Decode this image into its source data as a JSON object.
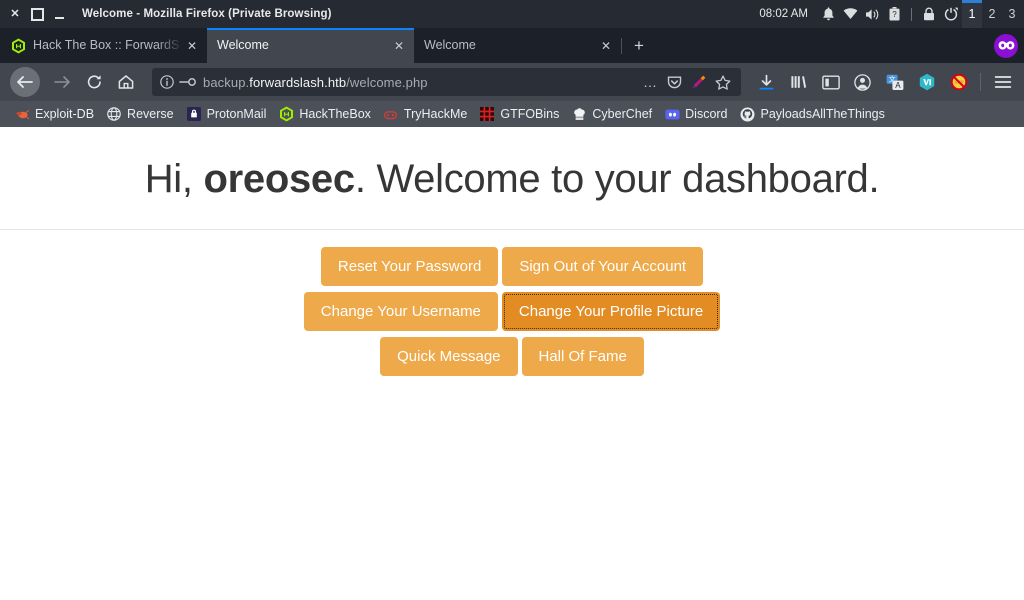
{
  "window": {
    "title": "Welcome - Mozilla Firefox (Private Browsing)",
    "controls": {
      "close": "close-window",
      "maximize": "maximize-window",
      "minimize": "minimize-window"
    }
  },
  "tray": {
    "clock": "08:02 AM",
    "icons": [
      "bell-icon",
      "wifi-icon",
      "volume-icon",
      "battery-unknown-icon"
    ],
    "session_icons": [
      "lock-screen-icon",
      "logout-icon"
    ],
    "workspaces": [
      "1",
      "2",
      "3"
    ],
    "active_workspace": "1"
  },
  "tabs": [
    {
      "title": "Hack The Box :: ForwardS",
      "favicon": "hackthebox-icon",
      "active": false,
      "close_label": "✕"
    },
    {
      "title": "Welcome",
      "favicon": "none",
      "active": true,
      "close_label": "✕"
    },
    {
      "title": "Welcome",
      "favicon": "none",
      "active": false,
      "close_label": "✕"
    }
  ],
  "tabstrip": {
    "new_tab_label": "+",
    "private_mode_icon": "private-browsing-mask-icon",
    "accent": "#0a84ff"
  },
  "navigation": {
    "back": "back-icon",
    "forward": "forward-icon",
    "reload": "reload-icon",
    "home": "home-icon"
  },
  "urlbar": {
    "identity_icon": "page-info-icon",
    "login_icon": "saved-login-key-icon",
    "url_prefix": "backup.",
    "url_host": "forwardslash.htb",
    "url_path": "/welcome.php",
    "full_url": "backup.forwardslash.htb/welcome.php",
    "page_actions_label": "…",
    "right_icons": [
      "page-actions-icon",
      "save-to-pocket-icon",
      "highlighter-icon",
      "bookmark-star-icon"
    ]
  },
  "toolbar": {
    "icons": [
      "downloads-icon",
      "library-icon",
      "sidebar-icon",
      "account-icon",
      "translate-extension-icon",
      "wappalyzer-extension-icon",
      "noscript-extension-icon"
    ],
    "menu_icon": "hamburger-menu-icon"
  },
  "bookmarks": [
    {
      "label": "Exploit-DB",
      "icon": "exploitdb-icon"
    },
    {
      "label": "Reverse",
      "icon": "globe-icon"
    },
    {
      "label": "ProtonMail",
      "icon": "protonmail-icon"
    },
    {
      "label": "HackTheBox",
      "icon": "hackthebox-icon"
    },
    {
      "label": "TryHackMe",
      "icon": "tryhackme-icon"
    },
    {
      "label": "GTFOBins",
      "icon": "gtfobins-icon"
    },
    {
      "label": "CyberChef",
      "icon": "cyberchef-icon"
    },
    {
      "label": "Discord",
      "icon": "discord-icon"
    },
    {
      "label": "PayloadsAllTheThings",
      "icon": "github-icon"
    }
  ],
  "content": {
    "greeting_prefix": "Hi, ",
    "username": "oreosec",
    "greeting_suffix": ". Welcome to your dashboard.",
    "buttons": [
      {
        "label": "Reset Your Password",
        "focused": false
      },
      {
        "label": "Sign Out of Your Account",
        "focused": false
      },
      {
        "label": "Change Your Username",
        "focused": false
      },
      {
        "label": "Change Your Profile Picture",
        "focused": true
      },
      {
        "label": "Quick Message",
        "focused": false
      },
      {
        "label": "Hall Of Fame",
        "focused": false
      }
    ],
    "button_color": "#eda94a",
    "button_color_active": "#e28c23",
    "button_text_color": "#ffffff"
  }
}
